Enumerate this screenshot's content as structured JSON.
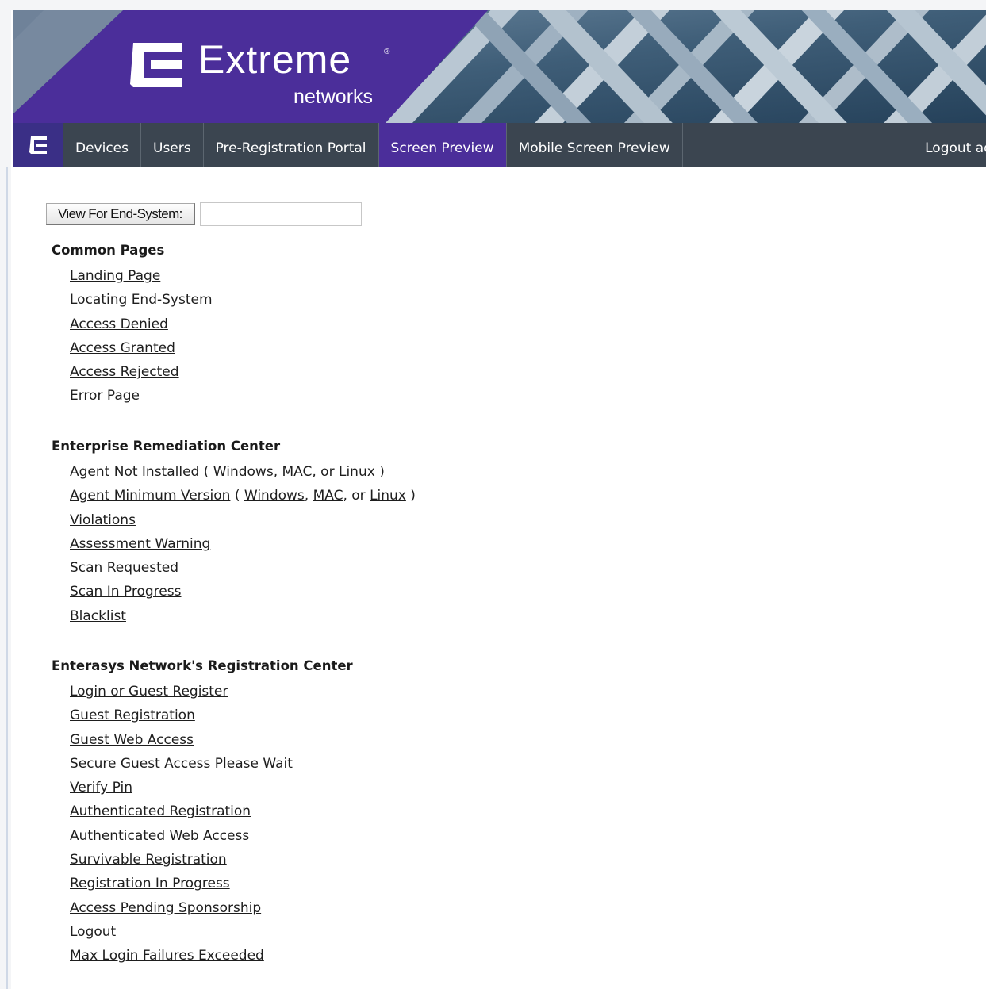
{
  "brand": {
    "name": "Extreme",
    "sub": "networks",
    "reg": "®",
    "colors": {
      "purple": "#4b2e9a",
      "navbar": "#3b4550",
      "banner_steel": "#3d5a73"
    },
    "home_icon": "extreme-e-icon"
  },
  "nav": {
    "tabs": [
      {
        "label": "Devices",
        "active": false
      },
      {
        "label": "Users",
        "active": false
      },
      {
        "label": "Pre-Registration Portal",
        "active": false
      },
      {
        "label": "Screen Preview",
        "active": true
      },
      {
        "label": "Mobile Screen Preview",
        "active": false
      }
    ],
    "logout": "Logout admin"
  },
  "view": {
    "button": "View For End-System:",
    "input_value": ""
  },
  "sections": [
    {
      "heading": "Common Pages",
      "links": [
        {
          "label": "Landing Page"
        },
        {
          "label": "Locating End-System"
        },
        {
          "label": "Access Denied"
        },
        {
          "label": "Access Granted"
        },
        {
          "label": "Access Rejected"
        },
        {
          "label": "Error Page"
        }
      ]
    },
    {
      "heading": "Enterprise Remediation Center",
      "links": [
        {
          "label": "Agent Not Installed",
          "platforms": [
            "Windows",
            "MAC",
            "Linux"
          ]
        },
        {
          "label": "Agent Minimum Version",
          "platforms": [
            "Windows",
            "MAC",
            "Linux"
          ]
        },
        {
          "label": "Violations"
        },
        {
          "label": "Assessment Warning"
        },
        {
          "label": "Scan Requested"
        },
        {
          "label": "Scan In Progress"
        },
        {
          "label": "Blacklist"
        }
      ]
    },
    {
      "heading": "Enterasys Network's Registration Center",
      "links": [
        {
          "label": "Login or Guest Register"
        },
        {
          "label": "Guest Registration"
        },
        {
          "label": "Guest Web Access"
        },
        {
          "label": "Secure Guest Access Please Wait"
        },
        {
          "label": "Verify Pin"
        },
        {
          "label": "Authenticated Registration"
        },
        {
          "label": "Authenticated Web Access"
        },
        {
          "label": "Survivable Registration"
        },
        {
          "label": "Registration In Progress"
        },
        {
          "label": "Access Pending Sponsorship"
        },
        {
          "label": "Logout"
        },
        {
          "label": "Max Login Failures Exceeded"
        }
      ]
    }
  ],
  "platform_text": {
    "open": "( ",
    "sep": ", ",
    "or": ", or ",
    "close": " )"
  }
}
